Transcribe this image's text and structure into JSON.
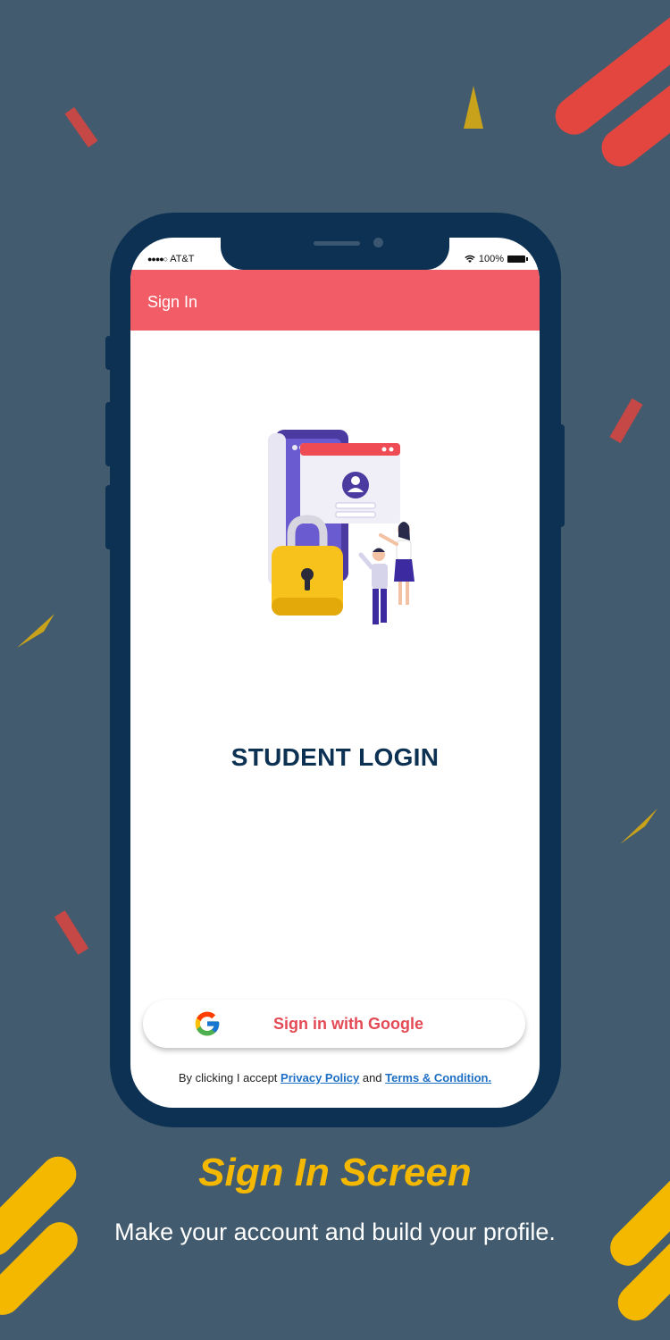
{
  "colors": {
    "background": "#425b6e",
    "phone_frame": "#0c3152",
    "app_bar": "#f25c66",
    "accent_yellow": "#f5b800",
    "accent_red": "#e2463f",
    "link": "#1c6fc4"
  },
  "status_bar": {
    "carrier": "AT&T",
    "battery": "100%"
  },
  "app_bar": {
    "title": "Sign In"
  },
  "main": {
    "illustration_icon": "login-security-illustration",
    "heading": "STUDENT LOGIN",
    "google_button_label": "Sign in with Google",
    "google_icon": "google-g-icon",
    "terms_prefix": "By clicking I accept",
    "privacy_link": "Privacy Policy",
    "terms_and": "and",
    "terms_link": "Terms & Condition."
  },
  "caption": {
    "title": "Sign In Screen",
    "subtitle": "Make your account and build your profile."
  }
}
